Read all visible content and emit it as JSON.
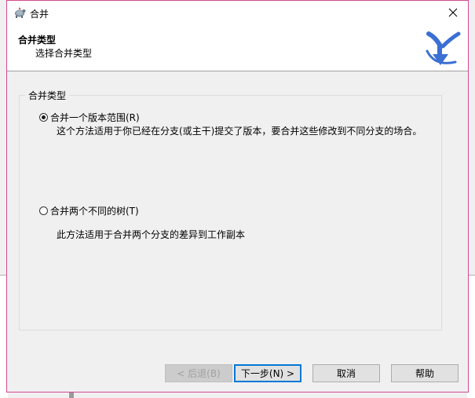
{
  "window": {
    "title": "合并"
  },
  "header": {
    "title": "合并类型",
    "subtitle": "选择合并类型"
  },
  "group": {
    "legend": "合并类型",
    "options": [
      {
        "label": "合并一个版本范围(R)",
        "checked": true,
        "description": "这个方法适用于你已经在分支(或主干)提交了版本，要合并这些修改到不同分支的场合。"
      },
      {
        "label": "合并两个不同的树(T)",
        "checked": false,
        "description": "此方法适用于合并两个分支的差异到工作副本"
      }
    ]
  },
  "buttons": {
    "back": "< 后退(B)",
    "next": "下一步(N) >",
    "cancel": "取消",
    "help": "帮助"
  },
  "colors": {
    "accent": "#0078d7",
    "logo": "#3b6fd4",
    "window_border": "#d34b8e"
  }
}
